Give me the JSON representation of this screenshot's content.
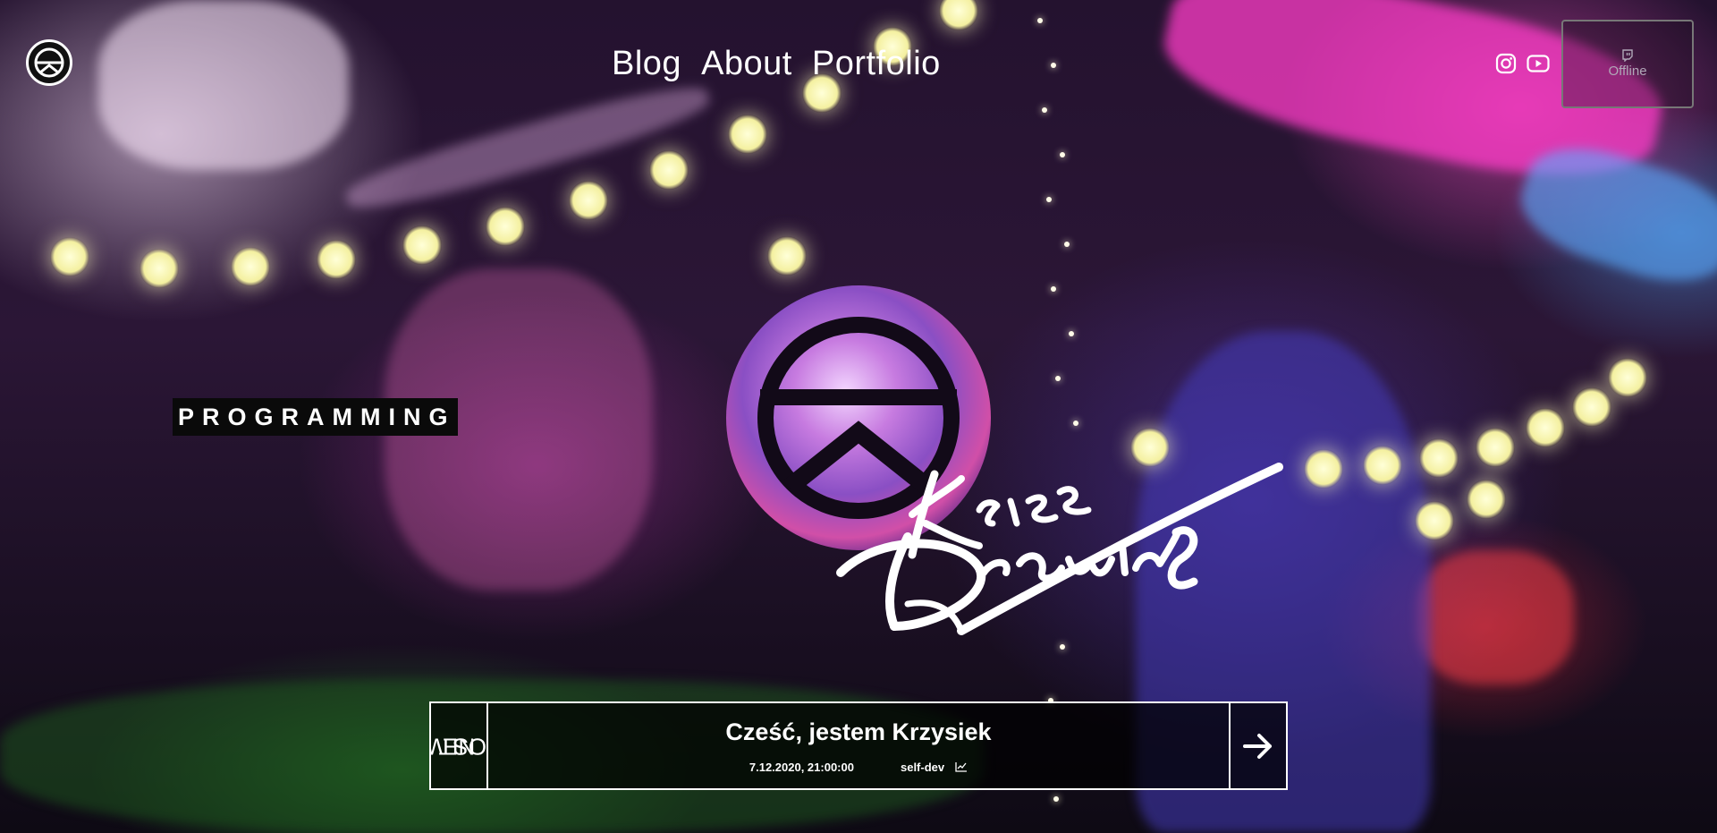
{
  "header": {
    "logo_icon": "kriss-logo-icon",
    "nav": [
      {
        "label": "Blog"
      },
      {
        "label": "About"
      },
      {
        "label": "Portfolio"
      }
    ],
    "social": [
      {
        "icon": "instagram-icon"
      },
      {
        "icon": "youtube-icon"
      }
    ],
    "twitch": {
      "icon": "twitch-icon",
      "status": "Offline"
    }
  },
  "hero": {
    "category": "PROGRAMMING",
    "logo_icon": "kriss-drawing-emblem",
    "signature": "Kriss Drawing"
  },
  "new_post": {
    "label_line1": "NEW",
    "label_line2": "POST",
    "title": "Cześć, jestem Krzysiek",
    "date": "7.12.2020, 21:00:00",
    "tag": "self-dev",
    "tag_icon": "chart-icon",
    "arrow_icon": "arrow-right-icon"
  },
  "colors": {
    "accent": "#ffffff",
    "bar_background": "#000000",
    "offline_text": "#b0a8b8"
  }
}
